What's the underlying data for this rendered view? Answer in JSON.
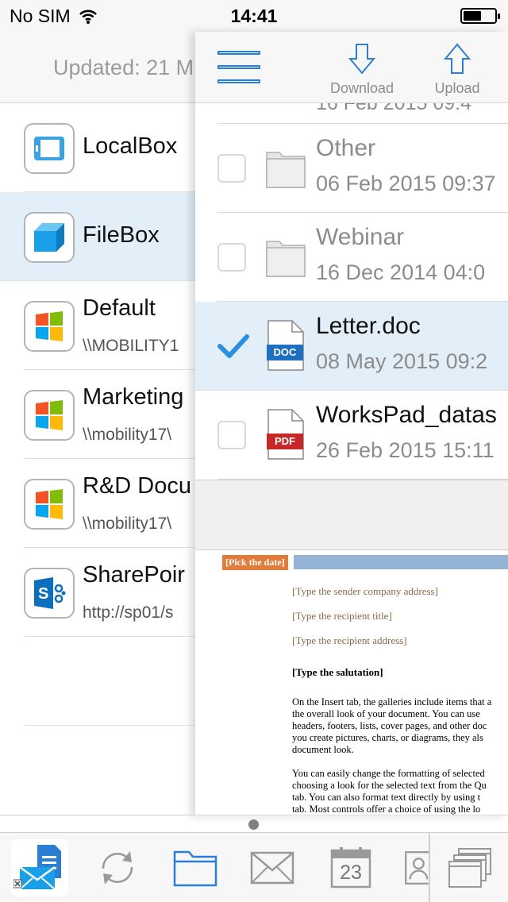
{
  "status_bar": {
    "carrier": "No SIM",
    "time": "14:41"
  },
  "left_panel": {
    "header_text": "Updated: 21 M",
    "accounts": [
      {
        "name": "LocalBox",
        "path": "",
        "icon": "localbox-icon",
        "selected": false
      },
      {
        "name": "FileBox",
        "path": "",
        "icon": "filebox-icon",
        "selected": true
      },
      {
        "name": "Default",
        "path": "\\\\MOBILITY1",
        "icon": "windows-share-icon",
        "selected": false
      },
      {
        "name": "Marketing",
        "path": "\\\\mobility17\\",
        "icon": "windows-share-icon",
        "selected": false
      },
      {
        "name": "R&D Docu",
        "path": "\\\\mobility17\\",
        "icon": "windows-share-icon",
        "selected": false
      },
      {
        "name": "SharePoir",
        "path": "http://sp01/s",
        "icon": "sharepoint-icon",
        "selected": false
      }
    ]
  },
  "toolbar": {
    "download_label": "Download",
    "upload_label": "Upload"
  },
  "files": {
    "cut_off_row": "16 Feb 2015 09:4",
    "items": [
      {
        "name": "Other",
        "date": "06 Feb 2015 09:37",
        "type": "folder",
        "checked": false
      },
      {
        "name": "Webinar",
        "date": "16 Dec 2014 04:0",
        "type": "folder",
        "checked": false
      },
      {
        "name": "Letter.doc",
        "date": "08 May 2015 09:2",
        "type": "doc",
        "badge": "DOC",
        "checked": true
      },
      {
        "name": "WorksPad_datas",
        "date": "26 Feb 2015 15:11",
        "type": "pdf",
        "badge": "PDF",
        "checked": false
      }
    ]
  },
  "preview": {
    "date_field": "[Pick the date]",
    "sender_address": "[Type the sender company address]",
    "recipient_title": "[Type the recipient title]",
    "recipient_address": "[Type the recipient address]",
    "salutation": "[Type the salutation]",
    "para1": [
      "On the Insert tab, the galleries include items that a",
      "the overall look of your document.  You can use",
      "headers, footers, lists, cover pages, and other doc",
      "you create pictures, charts, or diagrams, they als",
      "document look."
    ],
    "para2": [
      "You can easily change the formatting of selected",
      "choosing a look for the selected text from the Qu",
      "tab.  You can also format text directly by using t",
      "tab.  Most controls offer a choice of using the lo"
    ]
  },
  "tabbar": {
    "calendar_day": "23",
    "tabs": [
      "mail-app-icon",
      "sync-icon",
      "files-icon",
      "mail-icon",
      "calendar-icon",
      "contacts-icon",
      "windows-icon"
    ]
  },
  "colors": {
    "accent": "#2a7fd4",
    "selection": "#e2eff8",
    "doc_badge": "#1e6fbf",
    "pdf_badge": "#c62828",
    "pick_date": "#e07b39"
  }
}
